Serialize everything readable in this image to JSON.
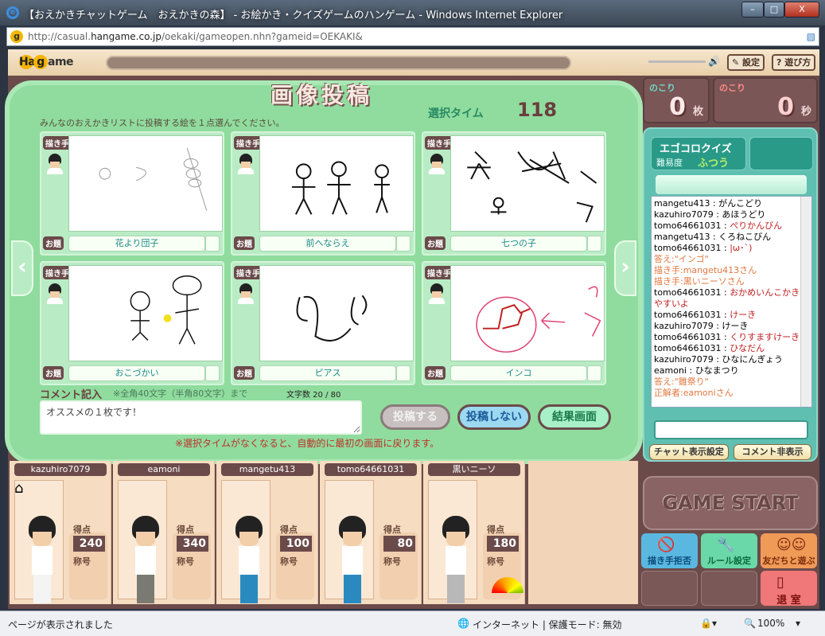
{
  "window": {
    "title": "【おえかきチャットゲーム　おえかきの森】 - お絵かき・クイズゲームのハンゲーム - Windows Internet Explorer",
    "min": "–",
    "max": "□",
    "close": "X"
  },
  "address": {
    "prefix": "http://casual.",
    "domain": "hangame.co.jp",
    "path": "/oekaki/gameopen.nhn?gameid=OEKAKI&"
  },
  "topbar": {
    "logo": "Han",
    "logo_g": "g",
    "logo_end": "ame",
    "settings": "設定",
    "howto": "遊び方"
  },
  "main": {
    "heading": "画像投稿",
    "select_time_label": "選択タイム",
    "select_time": "118",
    "instruction": "みんなのおえかきリストに投稿する絵を１点選んでください。",
    "drawer_label": "描き手",
    "topic_label": "お題",
    "cards": [
      {
        "topic": "花より団子"
      },
      {
        "topic": "前へならえ"
      },
      {
        "topic": "七つの子"
      },
      {
        "topic": "おこづかい"
      },
      {
        "topic": "ピアス"
      },
      {
        "topic": "インコ"
      }
    ],
    "comment_label": "コメント記入",
    "comment_hint": "※全角40文字（半角80文字）まで",
    "char_count": "文字数 20 / 80",
    "comment_value": "オススメの１枚です！",
    "post_button": "投稿する",
    "nopost_button": "投稿しない",
    "result_button": "結果画面",
    "notice": "※選択タイムがなくなると、自動的に最初の画面に戻ります。"
  },
  "counters": {
    "remaining_label": "のこり",
    "pictures": "0",
    "pictures_unit": "枚",
    "seconds": "0",
    "seconds_unit": "秒"
  },
  "quiz": {
    "name": "エゴコロクイズ",
    "difficulty_label": "難易度",
    "difficulty": "ふつう"
  },
  "chat": [
    {
      "user": "mangetu413",
      "text": "がんこどり",
      "type": "n"
    },
    {
      "user": "kazuhiro7079",
      "text": "あほうどり",
      "type": "n"
    },
    {
      "user": "tomo64661031",
      "text": "ぺりかんびん",
      "type": "r"
    },
    {
      "user": "mangetu413",
      "text": "くろねこびん",
      "type": "n"
    },
    {
      "user": "tomo64661031",
      "text": "|ω･`)",
      "type": "r"
    },
    {
      "user": "",
      "text": "答え:\"インゴ\"",
      "type": "s"
    },
    {
      "user": "",
      "text": "描き手:mangetu413さん",
      "type": "s"
    },
    {
      "user": "",
      "text": "描き手:黒いニーソさん",
      "type": "s"
    },
    {
      "user": "tomo64661031",
      "text": "おかめいんこかきやすいよ",
      "type": "r"
    },
    {
      "user": "tomo64661031",
      "text": "けーき",
      "type": "r"
    },
    {
      "user": "kazuhiro7079",
      "text": "けーき",
      "type": "n"
    },
    {
      "user": "tomo64661031",
      "text": "くりすますけーき",
      "type": "r"
    },
    {
      "user": "tomo64661031",
      "text": "ひなだん",
      "type": "r"
    },
    {
      "user": "kazuhiro7079",
      "text": "ひなにんぎょう",
      "type": "n"
    },
    {
      "user": "eamoni",
      "text": "ひなまつり",
      "type": "n"
    },
    {
      "user": "",
      "text": "答え:\"雛祭り\"",
      "type": "s"
    },
    {
      "user": "",
      "text": "正解者:eamoniさん",
      "type": "s"
    }
  ],
  "chat_buttons": {
    "display_settings": "チャット表示設定",
    "hide_comments": "コメント非表示"
  },
  "game_start": "GAME START",
  "side_buttons": {
    "refuse": "描き手拒否",
    "rules": "ルール設定",
    "friends": "友だちと遊ぶ",
    "leave": "退 室"
  },
  "players": {
    "score_label": "得点",
    "title_label": "称号",
    "list": [
      {
        "name": "kazuhiro7079",
        "score": "240",
        "outfit": "#ffffff",
        "pants": "#f4f4f4"
      },
      {
        "name": "eamoni",
        "score": "340",
        "outfit": "#ffffff",
        "pants": "#7a7a72"
      },
      {
        "name": "mangetu413",
        "score": "100",
        "outfit": "#ffffff",
        "pants": "#2a8ac0"
      },
      {
        "name": "tomo64661031",
        "score": "80",
        "outfit": "#ffffff",
        "pants": "#2a8ac0"
      },
      {
        "name": "黒いニーソ",
        "score": "180",
        "outfit": "#ffffff",
        "pants": "#b8b8b8"
      }
    ]
  },
  "status": {
    "text": "ページが表示されました",
    "zone": "インターネット | 保護モード: 無効",
    "zoom": "100%"
  }
}
